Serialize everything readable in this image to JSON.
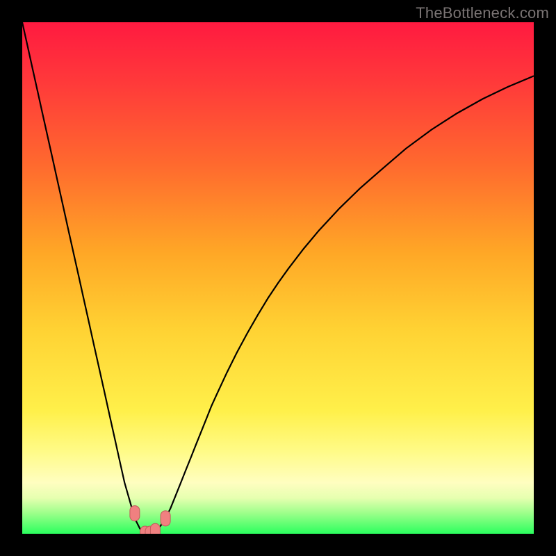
{
  "watermark": {
    "text": "TheBottleneck.com"
  },
  "colors": {
    "frame": "#000000",
    "watermark": "#7a7474",
    "curve_stroke": "#000000",
    "marker_fill": "#f08080",
    "marker_stroke": "#c05a5a",
    "gradient_stops": [
      {
        "offset": 0.0,
        "color": "#ff1a40"
      },
      {
        "offset": 0.12,
        "color": "#ff3a3a"
      },
      {
        "offset": 0.28,
        "color": "#ff6a2e"
      },
      {
        "offset": 0.45,
        "color": "#ffa726"
      },
      {
        "offset": 0.6,
        "color": "#ffd233"
      },
      {
        "offset": 0.76,
        "color": "#fff04a"
      },
      {
        "offset": 0.84,
        "color": "#fffb88"
      },
      {
        "offset": 0.9,
        "color": "#fffec0"
      },
      {
        "offset": 0.93,
        "color": "#e6ffb0"
      },
      {
        "offset": 0.96,
        "color": "#9cff8a"
      },
      {
        "offset": 1.0,
        "color": "#2bff5e"
      }
    ]
  },
  "chart_data": {
    "type": "line",
    "title": "",
    "xlabel": "",
    "ylabel": "",
    "xlim": [
      0,
      100
    ],
    "ylim": [
      0,
      100
    ],
    "x": [
      0,
      1,
      2,
      3,
      4,
      5,
      6,
      7,
      8,
      9,
      10,
      11,
      12,
      13,
      14,
      15,
      16,
      17,
      18,
      19,
      20,
      21,
      22,
      23,
      24,
      25,
      26,
      27,
      28,
      29,
      30,
      31,
      32,
      33,
      34,
      35,
      36,
      37,
      38,
      40,
      42,
      44,
      46,
      48,
      50,
      52,
      55,
      58,
      62,
      66,
      70,
      75,
      80,
      85,
      90,
      95,
      100
    ],
    "y": [
      100,
      95.5,
      91,
      86.5,
      82,
      77.5,
      73,
      68.5,
      64,
      59.5,
      55,
      50.5,
      46,
      41.5,
      37,
      32.5,
      28,
      23.5,
      19,
      14.5,
      10,
      6.5,
      3,
      1,
      0,
      0,
      0.5,
      1.5,
      3,
      5,
      7.5,
      10,
      12.5,
      15,
      17.5,
      20,
      22.5,
      25,
      27.2,
      31.5,
      35.5,
      39.2,
      42.7,
      46,
      49,
      51.8,
      55.7,
      59.3,
      63.6,
      67.5,
      71,
      75.3,
      79,
      82.2,
      85,
      87.4,
      89.5
    ],
    "markers": [
      {
        "x": 22,
        "y": 4
      },
      {
        "x": 24,
        "y": 0
      },
      {
        "x": 25,
        "y": 0
      },
      {
        "x": 26,
        "y": 0.5
      },
      {
        "x": 28,
        "y": 3
      }
    ]
  }
}
